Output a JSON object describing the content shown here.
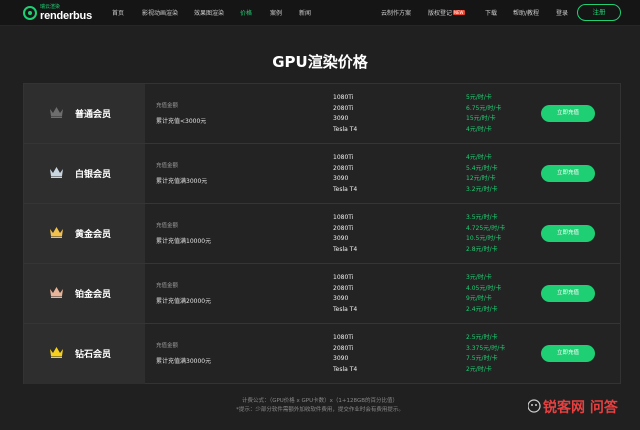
{
  "nav": {
    "logo_cn": "瑞云渲染",
    "logo_en": "renderbus",
    "items": [
      "首页",
      "影视动画渲染",
      "效果图渲染",
      "价格",
      "案例",
      "新闻"
    ],
    "active_index": 3,
    "right_items": [
      "云制作方案",
      "版权登记",
      "下载",
      "帮助/教程",
      "登录"
    ],
    "new_badge": "NEW",
    "register_label": "注册"
  },
  "page_title": "GPU渲染价格",
  "deposit_label": "充值金额",
  "recharge_label": "立即充值",
  "gpus": [
    "1080Ti",
    "2080Ti",
    "3090",
    "Tesla T4"
  ],
  "tiers": [
    {
      "name": "普通会员",
      "deposit": "累计充值<3000元",
      "prices": [
        "5元/时/卡",
        "6.75元/时/卡",
        "15元/时/卡",
        "4元/时/卡"
      ],
      "crown_color": "#6e6e6e"
    },
    {
      "name": "白银会员",
      "deposit": "累计充值满3000元",
      "prices": [
        "4元/时/卡",
        "5.4元/时/卡",
        "12元/时/卡",
        "3.2元/时/卡"
      ],
      "crown_color": "#c9d6e2"
    },
    {
      "name": "黄金会员",
      "deposit": "累计充值满10000元",
      "prices": [
        "3.5元/时/卡",
        "4.725元/时/卡",
        "10.5元/时/卡",
        "2.8元/时/卡"
      ],
      "crown_color": "#f2c14e"
    },
    {
      "name": "铂金会员",
      "deposit": "累计充值满20000元",
      "prices": [
        "3元/时/卡",
        "4.05元/时/卡",
        "9元/时/卡",
        "2.4元/时/卡"
      ],
      "crown_color": "#e8b49a"
    },
    {
      "name": "钻石会员",
      "deposit": "累计充值满30000元",
      "prices": [
        "2.5元/时/卡",
        "3.375元/时/卡",
        "7.5元/时/卡",
        "2元/时/卡"
      ],
      "crown_color": "#f7d11e"
    }
  ],
  "formula": "计费公式：（GPU价格 x GPU卡数）x（1+128GB的百分比值）",
  "hint": "*提示：少部分软件需额外加收软件费用，提交作业时会有费用提示。",
  "watermark": "锐客网 问答",
  "colors": {
    "accent": "#1fcf73",
    "background": "#202020"
  }
}
